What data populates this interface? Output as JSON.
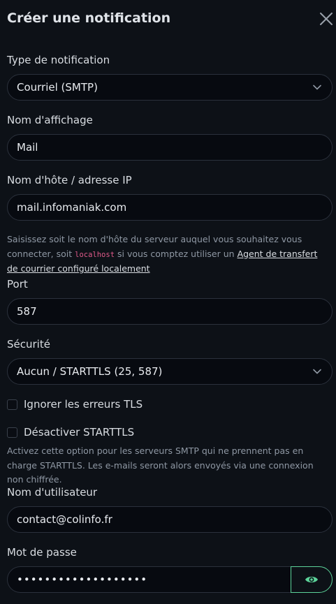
{
  "dialog": {
    "title": "Créer une notification"
  },
  "notification_type": {
    "label": "Type de notification",
    "value": "Courriel (SMTP)"
  },
  "display_name": {
    "label": "Nom d'affichage",
    "value": "Mail"
  },
  "hostname": {
    "label": "Nom d'hôte / adresse IP",
    "value": "mail.infomaniak.com",
    "help_before": "Saisissez soit le nom d'hôte du serveur auquel vous souhaitez vous connecter, soit ",
    "help_code": "localhost",
    "help_middle": " si vous comptez utiliser un ",
    "help_link": "Agent de transfert de courrier configuré localement"
  },
  "port": {
    "label": "Port",
    "value": "587"
  },
  "security": {
    "label": "Sécurité",
    "value": "Aucun / STARTTLS (25, 587)"
  },
  "ignore_tls": {
    "label": "Ignorer les erreurs TLS",
    "checked": false
  },
  "disable_starttls": {
    "label": "Désactiver STARTTLS",
    "checked": false,
    "help": "Activez cette option pour les serveurs SMTP qui ne prennent pas en charge STARTTLS. Les e-mails seront alors envoyés via une connexion non chiffrée."
  },
  "username": {
    "label": "Nom d'utilisateur",
    "value": "contact@colinfo.fr"
  },
  "password": {
    "label": "Mot de passe",
    "value": "•••••••••••••••••••"
  },
  "colors": {
    "accent": "#5cd39a",
    "background": "#0d1117",
    "input_bg": "#070a10",
    "code": "#e05a8a"
  },
  "icons": {
    "close": "close-icon",
    "chevron": "chevron-down-icon",
    "visibility": "eye-icon"
  }
}
